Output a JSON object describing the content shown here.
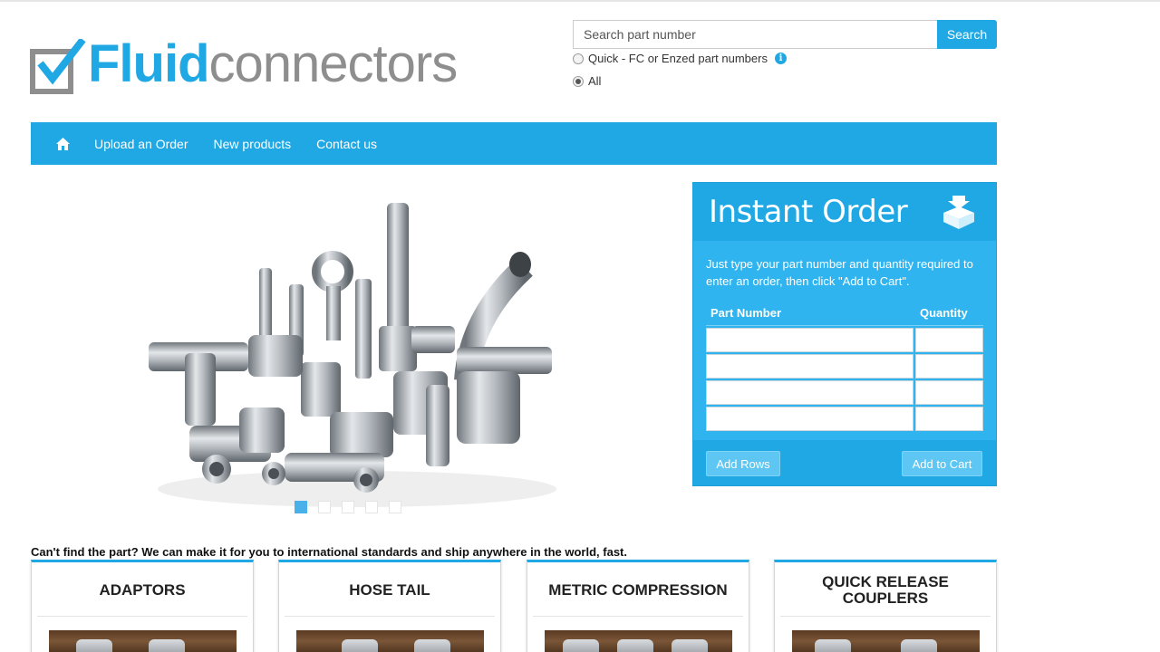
{
  "header": {
    "logo": {
      "bold_part": "Fluid",
      "light_part": "connectors"
    },
    "search": {
      "placeholder": "Search part number",
      "button_label": "Search",
      "option_quick": "Quick - FC or Enzed part numbers",
      "option_all": "All",
      "selected": "All"
    }
  },
  "nav": {
    "items": [
      {
        "label": "Upload an Order"
      },
      {
        "label": "New products"
      },
      {
        "label": "Contact us"
      }
    ]
  },
  "carousel": {
    "slide_count": 5,
    "active_slide": 1
  },
  "instant_order": {
    "title": "Instant Order",
    "description": "Just type your part number and quantity required to enter an order, then click \"Add to Cart\".",
    "col_part": "Part Number",
    "col_qty": "Quantity",
    "row_count": 4,
    "add_rows_label": "Add Rows",
    "add_cart_label": "Add to Cart"
  },
  "tagline": "Can't find the part? We can make it for you to international standards and ship anywhere in the world, fast.",
  "categories": [
    {
      "title": "ADAPTORS"
    },
    {
      "title": "HOSE TAIL"
    },
    {
      "title": "METRIC COMPRESSION"
    },
    {
      "title": "QUICK RELEASE COUPLERS"
    }
  ],
  "colors": {
    "brand_blue": "#1fa8e4",
    "logo_grey": "#8e8e8e",
    "panel_blue": "#2fb4ef"
  }
}
